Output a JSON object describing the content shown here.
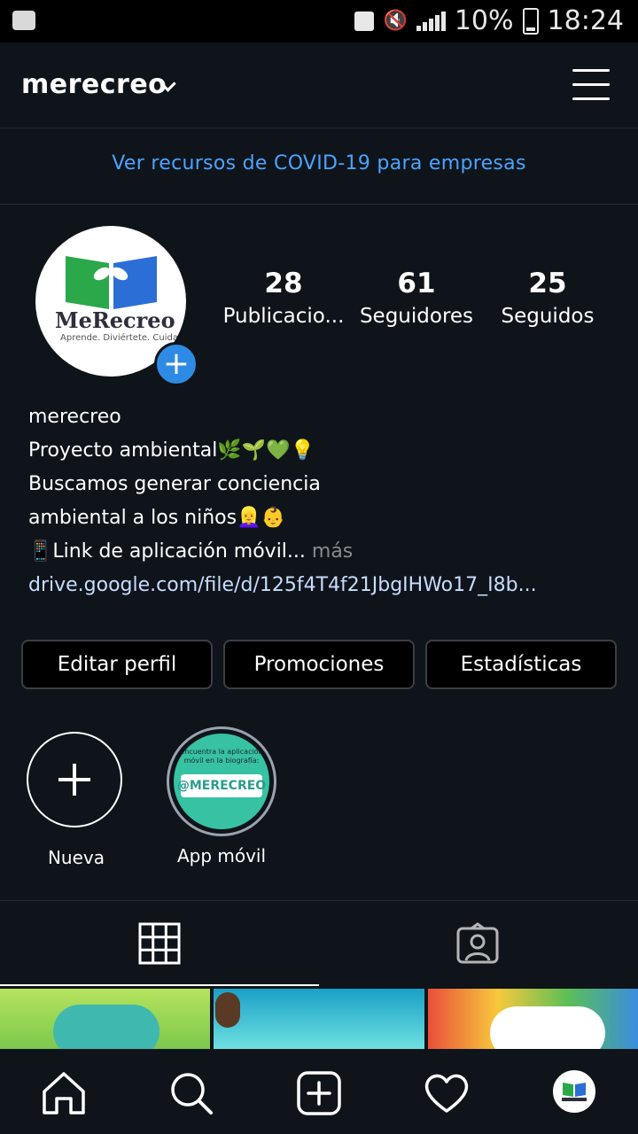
{
  "status_bar": {
    "battery": "10%",
    "time": "18:24"
  },
  "header": {
    "username": "merecreo"
  },
  "banner": {
    "text": "Ver recursos de COVID-19 para empresas"
  },
  "profile": {
    "avatar_logo_text": "MeRecreo",
    "avatar_logo_sub": "Aprende. Diviértete. Cuida",
    "stats": [
      {
        "value": "28",
        "label": "Publicacio..."
      },
      {
        "value": "61",
        "label": "Seguidores"
      },
      {
        "value": "25",
        "label": "Seguidos"
      }
    ],
    "bio": {
      "name": "merecreo",
      "line1": "Proyecto ambiental🌿🌱💚💡",
      "line2": "Buscamos generar conciencia",
      "line3": "ambiental a los niños👱‍♀️👶",
      "line4": "📱Link de aplicación móvil...",
      "more": " más",
      "link": "drive.google.com/file/d/125f4T4f21JbgIHWo17_I8b..."
    }
  },
  "buttons": {
    "edit": "Editar perfil",
    "promotions": "Promociones",
    "stats": "Estadísticas"
  },
  "highlights": [
    {
      "label": "Nueva"
    },
    {
      "label": "App móvil",
      "text_top": "encuentra la aplicación móvil en la biografía:",
      "tag": "@MERECREO"
    }
  ],
  "tabs": [
    "grid-icon",
    "tagged-icon"
  ],
  "colors": {
    "accent": "#2e8be5",
    "link": "#4aa4ff",
    "bg": "#0f141b"
  }
}
